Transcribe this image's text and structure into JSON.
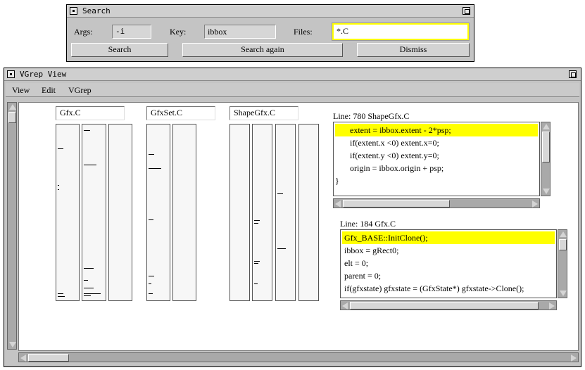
{
  "search_window": {
    "title": "Search",
    "args_label": "Args:",
    "args_value": "-i",
    "key_label": "Key:",
    "key_value": "ibbox",
    "files_label": "Files:",
    "files_value": "*.C",
    "search_button": "Search",
    "search_again_button": "Search again",
    "dismiss_button": "Dismiss"
  },
  "vgrep_window": {
    "title": "VGrep View",
    "menu": [
      "View",
      "Edit",
      "VGrep"
    ],
    "files": [
      "Gfx.C",
      "GfxSet.C",
      "ShapeGfx.C"
    ],
    "viewer_top": {
      "header": "Line: 780 ShapeGfx.C",
      "lines": [
        "       extent = ibbox.extent - 2*psp;",
        "       if(extent.x <0) extent.x=0;",
        "       if(extent.y <0) extent.y=0;",
        "       origin = ibbox.origin + psp;",
        "}"
      ]
    },
    "viewer_bottom": {
      "header": "Line: 184 Gfx.C",
      "lines": [
        "Gfx_BASE::InitClone();",
        "ibbox = gRect0;",
        "elt = 0;",
        "parent = 0;",
        "if(gfxstate) gfxstate = (GfxState*) gfxstate->Clone();"
      ]
    }
  }
}
